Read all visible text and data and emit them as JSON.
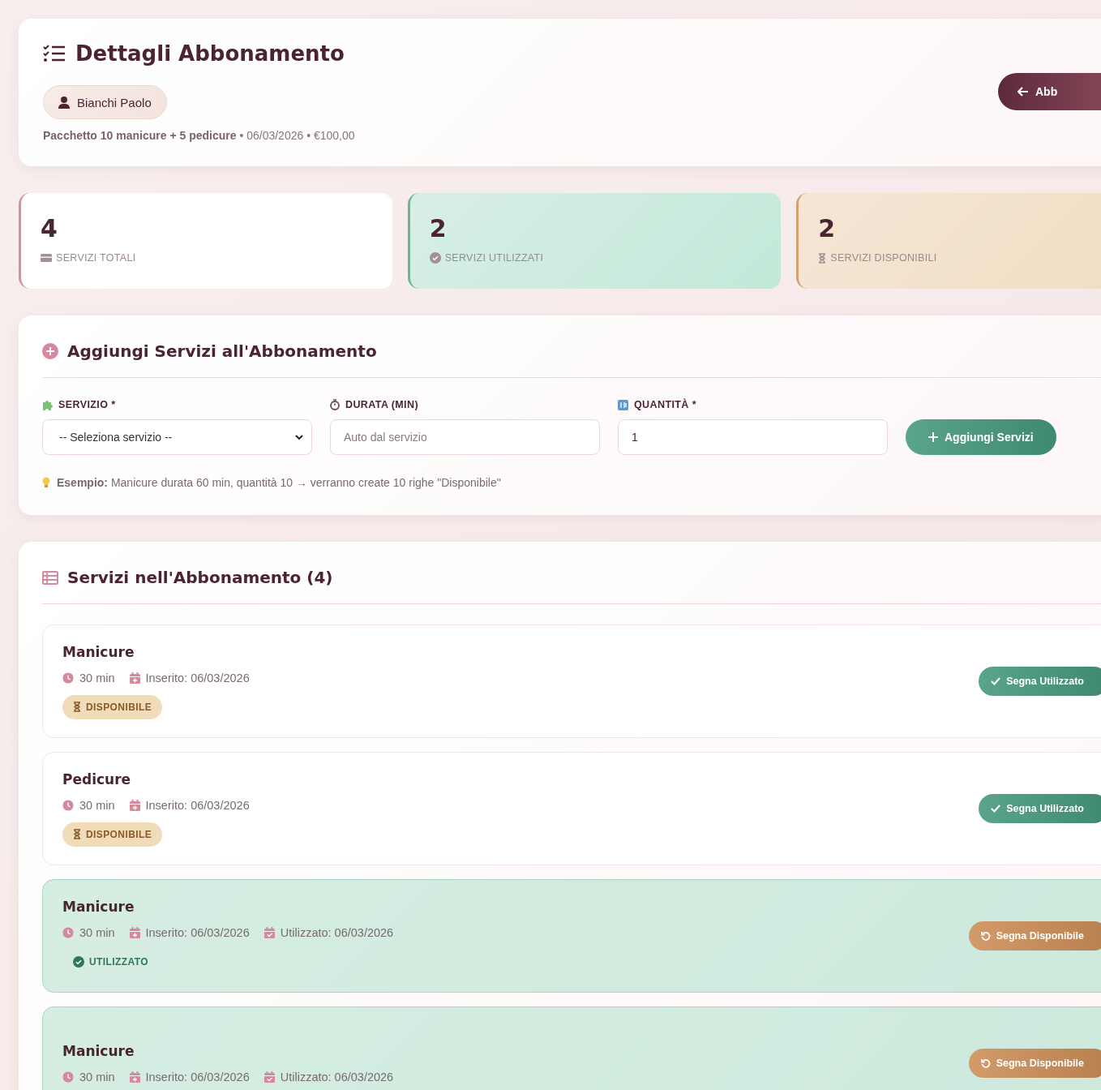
{
  "header": {
    "title": "Dettagli Abbonamento",
    "client": "Bianchi Paolo",
    "package": "Pacchetto 10 manicure + 5 pedicure",
    "separator": "•",
    "date": "06/03/2026",
    "price": "€100,00",
    "back_button": "Abb"
  },
  "stats": [
    {
      "kind": "total",
      "value": "4",
      "label": "SERVIZI TOTALI"
    },
    {
      "kind": "used",
      "value": "2",
      "label": "SERVIZI UTILIZZATI"
    },
    {
      "kind": "available",
      "value": "2",
      "label": "SERVIZI DISPONIBILI"
    }
  ],
  "add_form": {
    "title": "Aggiungi Servizi all'Abbonamento",
    "service_label": "SERVIZIO *",
    "service_value": "-- Seleziona servizio --",
    "duration_label": "DURATA (MIN)",
    "duration_placeholder": "Auto dal servizio",
    "quantity_label": "QUANTITÀ *",
    "quantity_value": "1",
    "submit": "Aggiungi Servizi",
    "hint_bold": "Esempio:",
    "hint": "Manicure durata 60 min, quantità 10 → verranno create 10 righe \"Disponibile\""
  },
  "services": {
    "title": "Servizi nell'Abbonamento (4)",
    "items": [
      {
        "name": "Manicure",
        "kind": "available",
        "duration": "30 min",
        "inserted": "Inserito: 06/03/2026",
        "badge": "DISPONIBILE",
        "action": "Segna Utilizzato"
      },
      {
        "name": "Pedicure",
        "kind": "available",
        "duration": "30 min",
        "inserted": "Inserito: 06/03/2026",
        "badge": "DISPONIBILE",
        "action": "Segna Utilizzato"
      },
      {
        "name": "Manicure",
        "kind": "used",
        "duration": "30 min",
        "inserted": "Inserito: 06/03/2026",
        "used": "Utilizzato: 06/03/2026",
        "badge": "UTILIZZATO",
        "action": "Segna Disponibile"
      },
      {
        "name": "Manicure",
        "kind": "used",
        "duration": "30 min",
        "inserted": "Inserito: 06/03/2026",
        "used": "Utilizzato: 06/03/2026",
        "action": "Segna Disponibile"
      }
    ]
  }
}
